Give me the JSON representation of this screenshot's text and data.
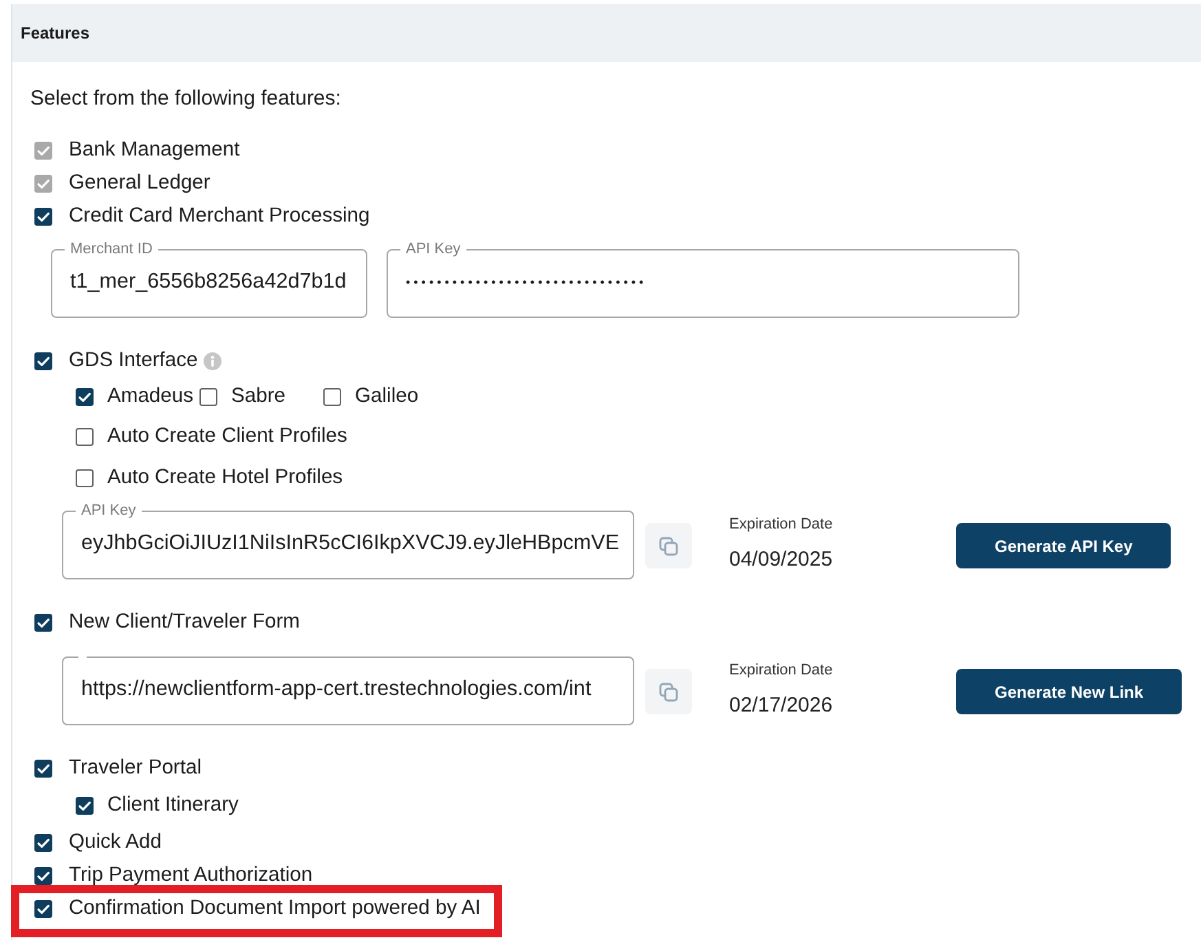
{
  "panel": {
    "title": "Features"
  },
  "intro": "Select from the following features:",
  "features": [
    {
      "label": "Bank Management",
      "checked": true,
      "disabled": true,
      "info": false,
      "highlighted": false
    },
    {
      "label": "General Ledger",
      "checked": true,
      "disabled": true,
      "info": false,
      "highlighted": false
    },
    {
      "label": "Credit Card Merchant Processing",
      "checked": true,
      "disabled": false,
      "info": false,
      "highlighted": false,
      "fields": [
        {
          "label": "Merchant ID",
          "value": "t1_mer_6556b8256a42d7b1d",
          "masked": false
        },
        {
          "label": "API Key",
          "value": "•••••••••••••••••••••••••••••••",
          "masked": true
        }
      ]
    },
    {
      "label": "GDS Interface",
      "checked": true,
      "disabled": false,
      "info": true,
      "highlighted": false,
      "providers": [
        {
          "label": "Amadeus",
          "checked": true
        },
        {
          "label": "Sabre",
          "checked": false
        },
        {
          "label": "Galileo",
          "checked": false
        }
      ],
      "options": [
        {
          "label": "Auto Create Client Profiles",
          "checked": false
        },
        {
          "label": "Auto Create Hotel Profiles",
          "checked": false
        }
      ],
      "key_row": {
        "field": {
          "label": "API Key",
          "value": "eyJhbGciOiJIUzI1NiIsInR5cCI6IkpXVCJ9.eyJleHBpcmVE",
          "masked": false
        },
        "expiration_label": "Expiration Date",
        "expiration_date": "04/09/2025",
        "button": "Generate API Key"
      }
    },
    {
      "label": "New Client/Traveler Form",
      "checked": true,
      "disabled": false,
      "info": false,
      "highlighted": false,
      "key_row": {
        "field": {
          "value": "https://newclientform-app-cert.trestechnologies.com/int",
          "masked": false
        },
        "expiration_label": "Expiration Date",
        "expiration_date": "02/17/2026",
        "button": "Generate New Link"
      }
    },
    {
      "label": "Traveler Portal",
      "checked": true,
      "disabled": false,
      "info": false,
      "highlighted": false,
      "options": [
        {
          "label": "Client Itinerary",
          "checked": true
        }
      ]
    },
    {
      "label": "Quick Add",
      "checked": true,
      "disabled": false,
      "info": false,
      "highlighted": false
    },
    {
      "label": "Trip Payment Authorization",
      "checked": true,
      "disabled": false,
      "info": false,
      "highlighted": false
    },
    {
      "label": "Confirmation Document Import powered by AI",
      "checked": true,
      "disabled": false,
      "info": false,
      "highlighted": true
    }
  ]
}
